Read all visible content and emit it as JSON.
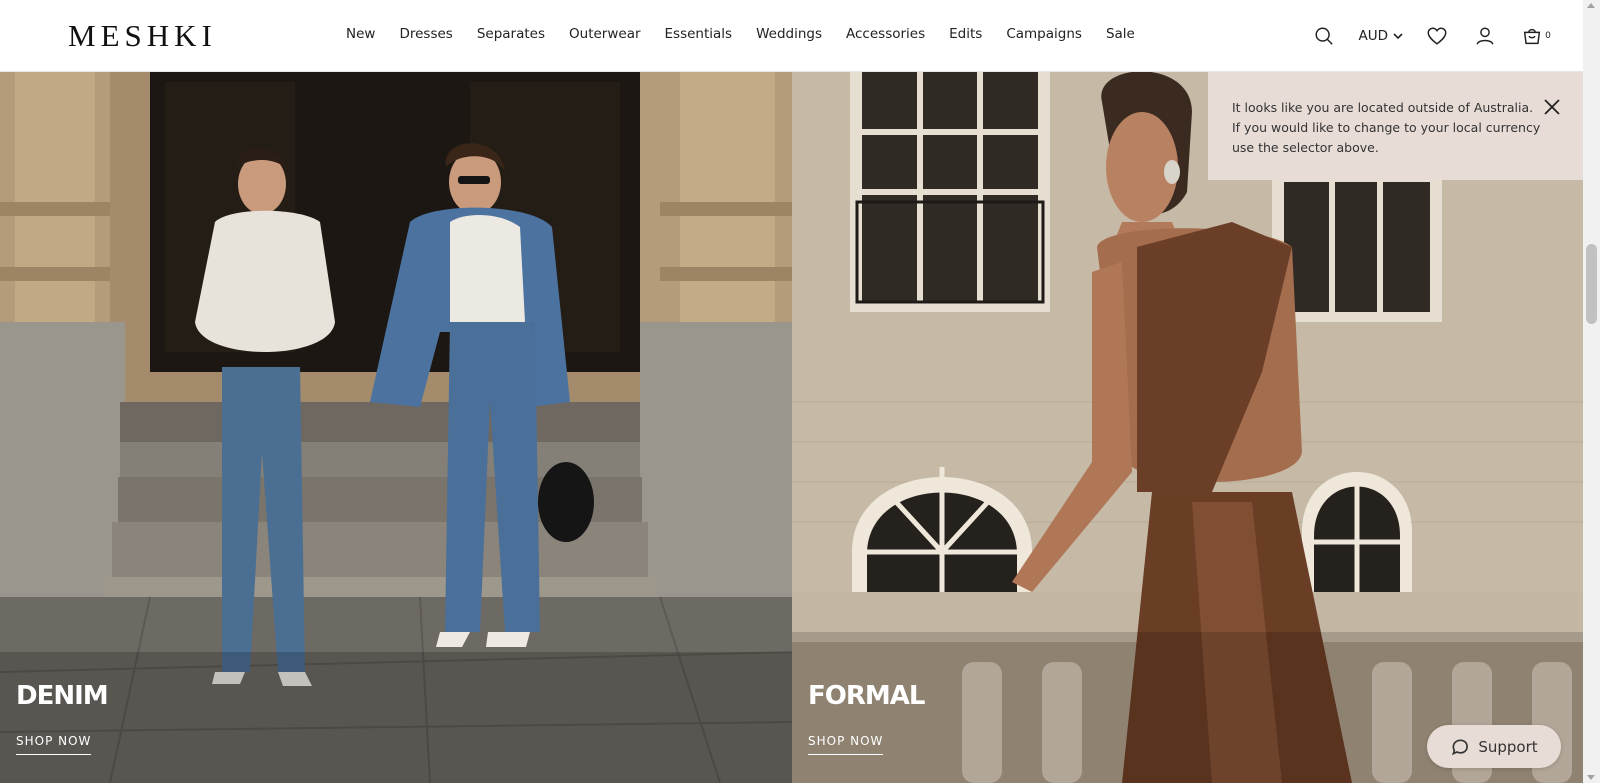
{
  "header": {
    "logo": "MESHKI",
    "nav": [
      "New",
      "Dresses",
      "Separates",
      "Outerwear",
      "Essentials",
      "Weddings",
      "Accessories",
      "Edits",
      "Campaigns",
      "Sale"
    ],
    "currency": "AUD",
    "cart_count": "0",
    "icons": [
      "search-icon",
      "chevron-down-icon",
      "heart-icon",
      "account-icon",
      "bag-icon"
    ]
  },
  "panels": [
    {
      "title": "DENIM",
      "link": "SHOP NOW"
    },
    {
      "title": "FORMAL",
      "link": "SHOP NOW"
    }
  ],
  "notice": {
    "text": "It looks like you are located outside of Australia. If you would like to change to your local currency use the selector above."
  },
  "support": {
    "label": "Support"
  },
  "colors": {
    "notice_bg": "#e8dcd7",
    "support_bg": "#e8dcd7",
    "text": "#222222"
  }
}
